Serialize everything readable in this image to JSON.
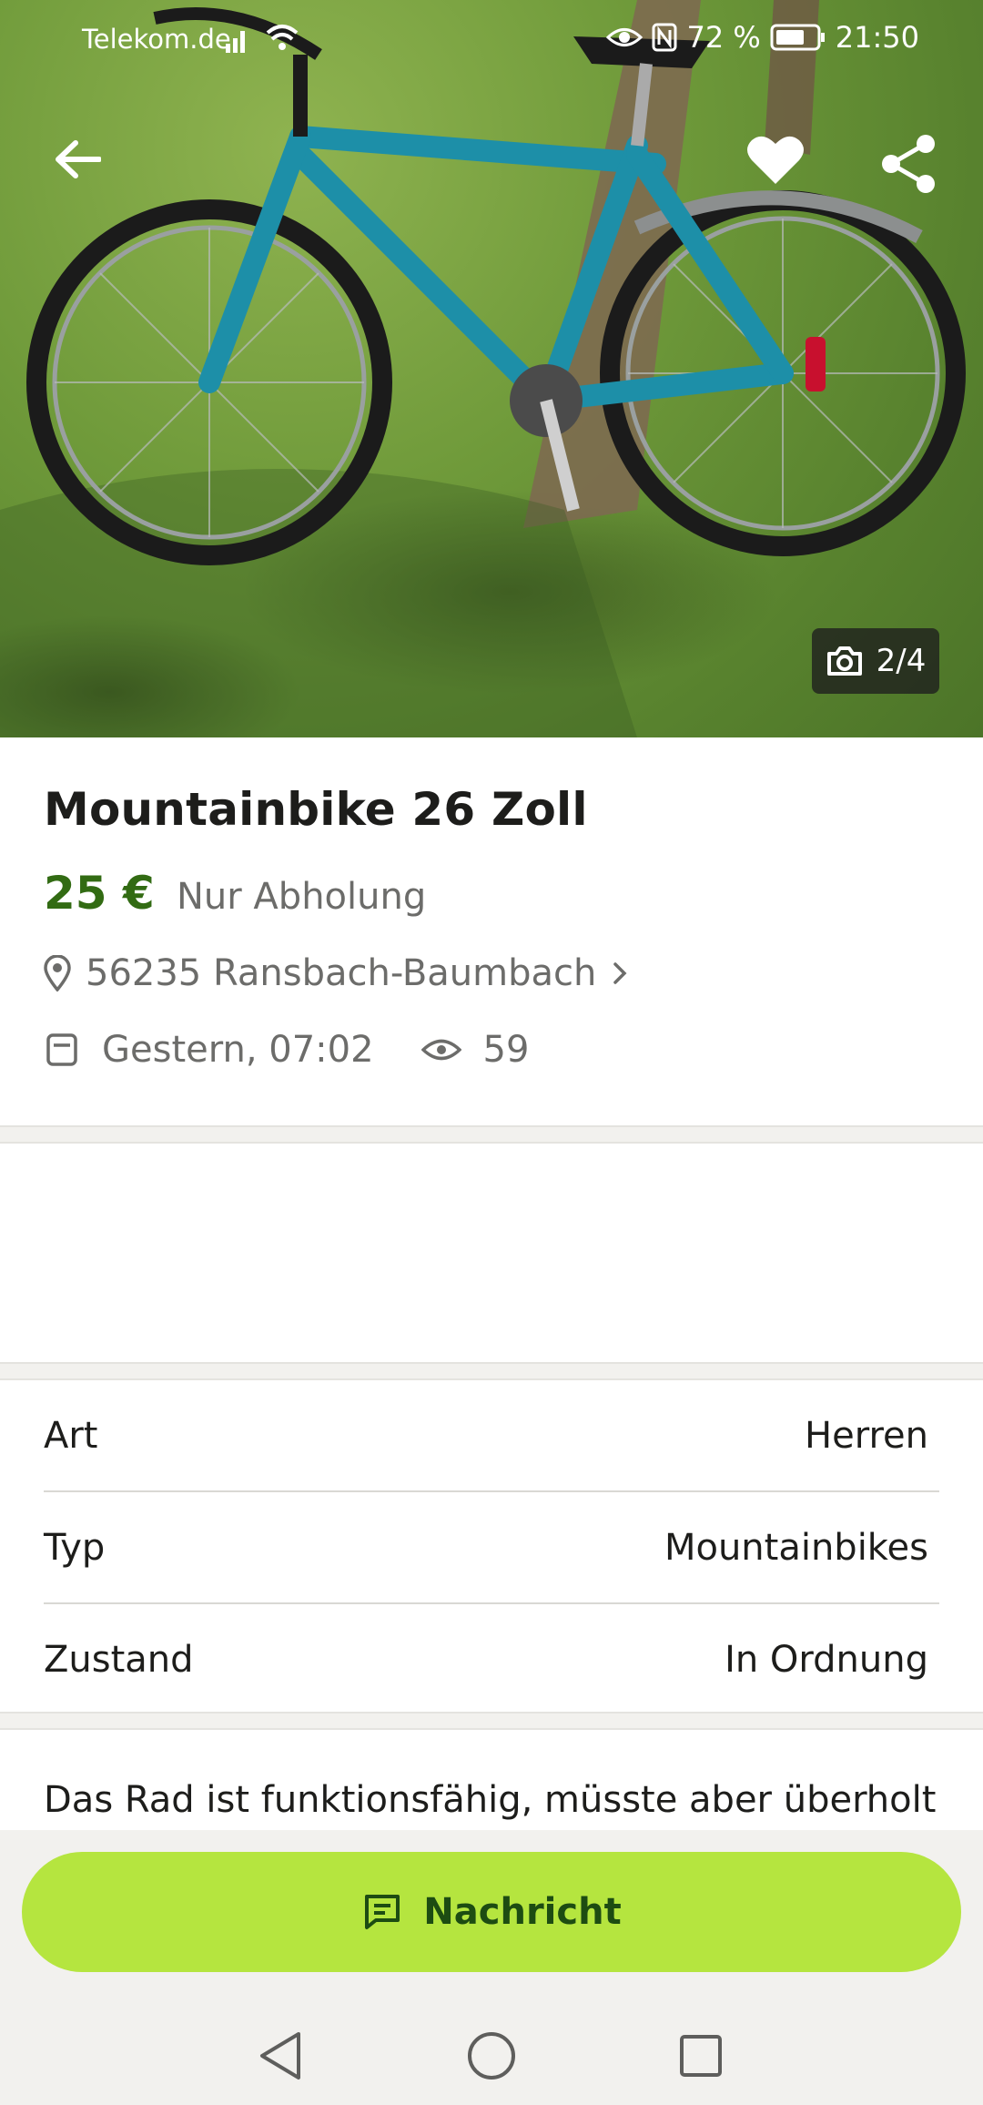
{
  "status_bar": {
    "carrier": "Telekom.de",
    "battery": "72 %",
    "time": "21:50",
    "icons": [
      "signal-icon",
      "wifi-icon",
      "eye-comfort-icon",
      "nfc-icon",
      "battery-icon"
    ]
  },
  "gallery": {
    "counter": "2/4",
    "icons": [
      "back-arrow-icon",
      "heart-icon",
      "share-icon",
      "camera-icon"
    ]
  },
  "listing": {
    "title": "Mountainbike 26 Zoll",
    "price": "25 €",
    "shipping": "Nur Abholung",
    "location": "56235 Ransbach-Baumbach",
    "date": "Gestern, 07:02",
    "views": "59"
  },
  "attributes": [
    {
      "label": "Art",
      "value": "Herren"
    },
    {
      "label": "Typ",
      "value": "Mountainbikes"
    },
    {
      "label": "Zustand",
      "value": "In Ordnung"
    }
  ],
  "description": "Das Rad ist funktionsfähig, müsste aber überholt",
  "action": {
    "message_label": "Nachricht"
  },
  "colors": {
    "price_green": "#326b13",
    "button_lime": "#b5e53f",
    "button_text": "#1d4c12",
    "bike_teal": "#1d8fa8"
  }
}
